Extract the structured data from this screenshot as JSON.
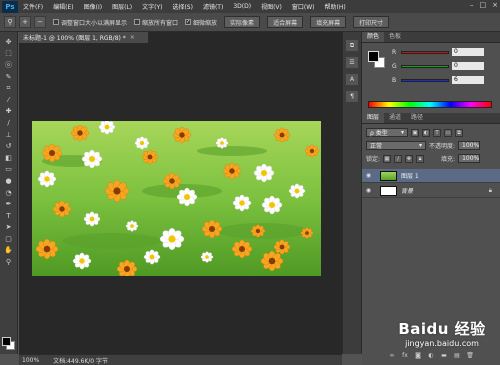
{
  "app": {
    "logo": "Ps"
  },
  "menu": [
    "文件(F)",
    "编辑(E)",
    "图像(I)",
    "图层(L)",
    "文字(Y)",
    "选择(S)",
    "滤镜(T)",
    "3D(D)",
    "视图(V)",
    "窗口(W)",
    "帮助(H)"
  ],
  "window_controls": {
    "minimize": "–",
    "maximize": "□",
    "close": "×"
  },
  "options": {
    "zoom_in_icon": "+",
    "zoom_out_icon": "−",
    "check1_label": "调整窗口大小以满屏显示",
    "check1_checked": false,
    "check2_label": "缩放所有窗口",
    "check2_checked": false,
    "check3_label": "细微缩放",
    "check3_checked": true,
    "btn_actual": "实际像素",
    "btn_fit": "适合屏幕",
    "btn_fill": "填充屏幕",
    "btn_print": "打印尺寸"
  },
  "document": {
    "tab_title": "未标题-1 @ 100% (图层 1, RGB/8) *",
    "tab_close": "×"
  },
  "status": {
    "zoom": "100%",
    "doc_info": "文档:449.6K/0 字节"
  },
  "color_panel": {
    "tab_color": "颜色",
    "tab_swatches": "色板",
    "r_label": "R",
    "g_label": "G",
    "b_label": "B",
    "r_value": "0",
    "g_value": "0",
    "b_value": "6",
    "colors": {
      "r_track": "#c01818",
      "g_track": "#1aa01a",
      "b_track": "#1a2fd0"
    }
  },
  "layers_panel": {
    "tabs": [
      "图层",
      "通道",
      "路径"
    ],
    "active_tab": "图层",
    "filter_label": "ρ 类型",
    "blend_mode": "正常",
    "opacity_label": "不透明度:",
    "opacity_value": "100%",
    "lock_label": "锁定:",
    "fill_label": "填充:",
    "fill_value": "100%",
    "layers": [
      {
        "name": "图层 1",
        "selected": true,
        "thumb": "grass"
      },
      {
        "name": "背景",
        "selected": false,
        "thumb": "white"
      }
    ]
  },
  "watermark": {
    "brand": "Baidu 经验",
    "url": "jingyan.baidu.com"
  }
}
